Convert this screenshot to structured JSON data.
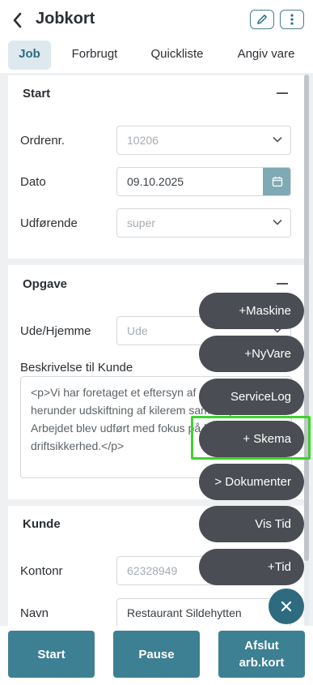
{
  "header": {
    "back_icon": "chevron-left-icon",
    "title": "Jobkort",
    "edit_icon": "pencil-icon",
    "more_icon": "more-vertical-icon"
  },
  "tabs": [
    {
      "label": "Job",
      "active": true
    },
    {
      "label": "Forbrugt",
      "active": false
    },
    {
      "label": "Quickliste",
      "active": false
    },
    {
      "label": "Angiv vare",
      "active": false
    }
  ],
  "start_section": {
    "title": "Start",
    "order_label": "Ordrenr.",
    "order_value": "10206",
    "date_label": "Dato",
    "date_value": "09.10.2025",
    "performer_label": "Udførende",
    "performer_value": "super"
  },
  "task_section": {
    "title": "Opgave",
    "location_label": "Ude/Hjemme",
    "location_value": "Ude",
    "description_label": "Beskrivelse til Kunde",
    "description_value": "<p>Vi har foretaget et eftersyn af maskine, herunder udskiftning af kilerem samt to pærer. Arbejdet blev udført med fokus på kvalitet og driftsikkerhed.</p>"
  },
  "customer_section": {
    "title": "Kunde",
    "account_label": "Kontonr",
    "account_value": "62328949",
    "name_label": "Navn",
    "name_value": "Restaurant Sildehytten"
  },
  "fab_menu": {
    "items": [
      "+Maskine",
      "+NyVare",
      "ServiceLog",
      "+ Skema",
      "> Dokumenter",
      "Vis Tid",
      "+Tid"
    ],
    "highlighted": "+ Skema",
    "highlight_color": "#3dd32b",
    "close_icon": "close-icon"
  },
  "bottom_bar": {
    "start_label": "Start",
    "pause_label": "Pause",
    "finish_label_line1": "Afslut",
    "finish_label_line2": "arb.kort"
  },
  "colors": {
    "accent": "#3d7f93",
    "fab_bg": "#4a4d53"
  }
}
